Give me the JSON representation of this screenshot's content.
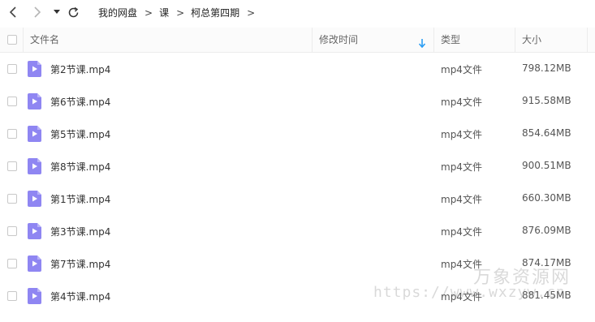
{
  "nav": {
    "breadcrumbs": [
      "我的网盘",
      "课",
      "柯总第四期"
    ],
    "separator": ">",
    "icons": [
      "back-arrow-icon",
      "forward-arrow-icon",
      "history-dropdown-icon",
      "refresh-icon"
    ]
  },
  "table": {
    "headers": {
      "name": "文件名",
      "modified": "修改时间",
      "type": "类型",
      "size": "大小"
    },
    "sorted_column": "modified",
    "rows": [
      {
        "name": "第2节课.mp4",
        "type": "mp4文件",
        "size": "798.12MB"
      },
      {
        "name": "第6节课.mp4",
        "type": "mp4文件",
        "size": "915.58MB"
      },
      {
        "name": "第5节课.mp4",
        "type": "mp4文件",
        "size": "854.64MB"
      },
      {
        "name": "第8节课.mp4",
        "type": "mp4文件",
        "size": "900.51MB"
      },
      {
        "name": "第1节课.mp4",
        "type": "mp4文件",
        "size": "660.30MB"
      },
      {
        "name": "第3节课.mp4",
        "type": "mp4文件",
        "size": "876.09MB"
      },
      {
        "name": "第7节课.mp4",
        "type": "mp4文件",
        "size": "874.17MB"
      },
      {
        "name": "第4节课.mp4",
        "type": "mp4文件",
        "size": "881.45MB"
      }
    ]
  },
  "watermark": {
    "line1": "万象资源网",
    "line2": "https://www.wxzyw.cn"
  },
  "colors": {
    "accent": "#2a9df4",
    "video_icon": "#8f86f2"
  }
}
